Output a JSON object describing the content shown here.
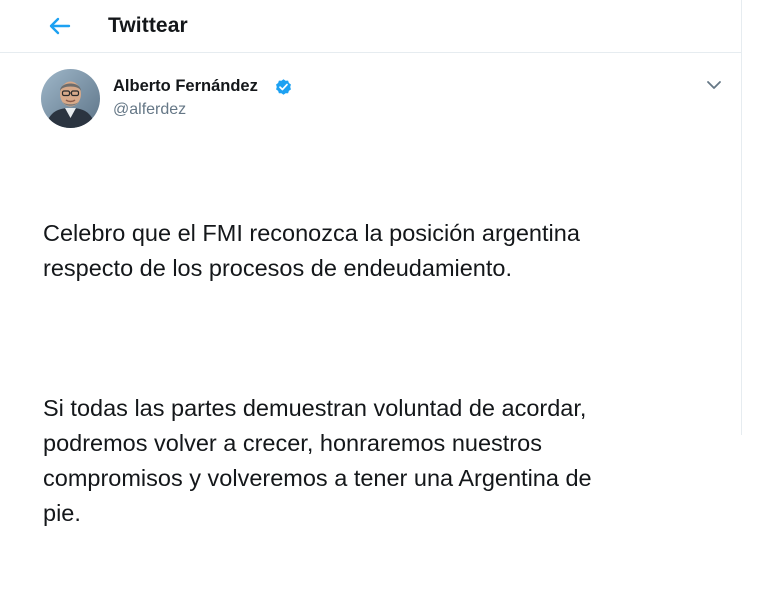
{
  "header": {
    "title": "Twittear",
    "back_icon": "arrow-left-icon"
  },
  "tweet": {
    "author": {
      "display_name": "Alberto Fernández",
      "handle": "@alferdez",
      "verified_icon": "verified-badge-icon"
    },
    "menu_icon": "chevron-down-icon",
    "paragraphs": [
      "Celebro que el FMI reconozca la posición argentina\nrespecto de los procesos de endeudamiento.",
      "Si todas las partes demuestran voluntad de acordar,\npodremos volver a crecer, honraremos nuestros\ncompromisos y volveremos a tener una Argentina de\npie."
    ]
  },
  "colors": {
    "accent": "#1da1f2",
    "text": "#14171a",
    "muted": "#657786",
    "divider": "#e6ecf0"
  }
}
